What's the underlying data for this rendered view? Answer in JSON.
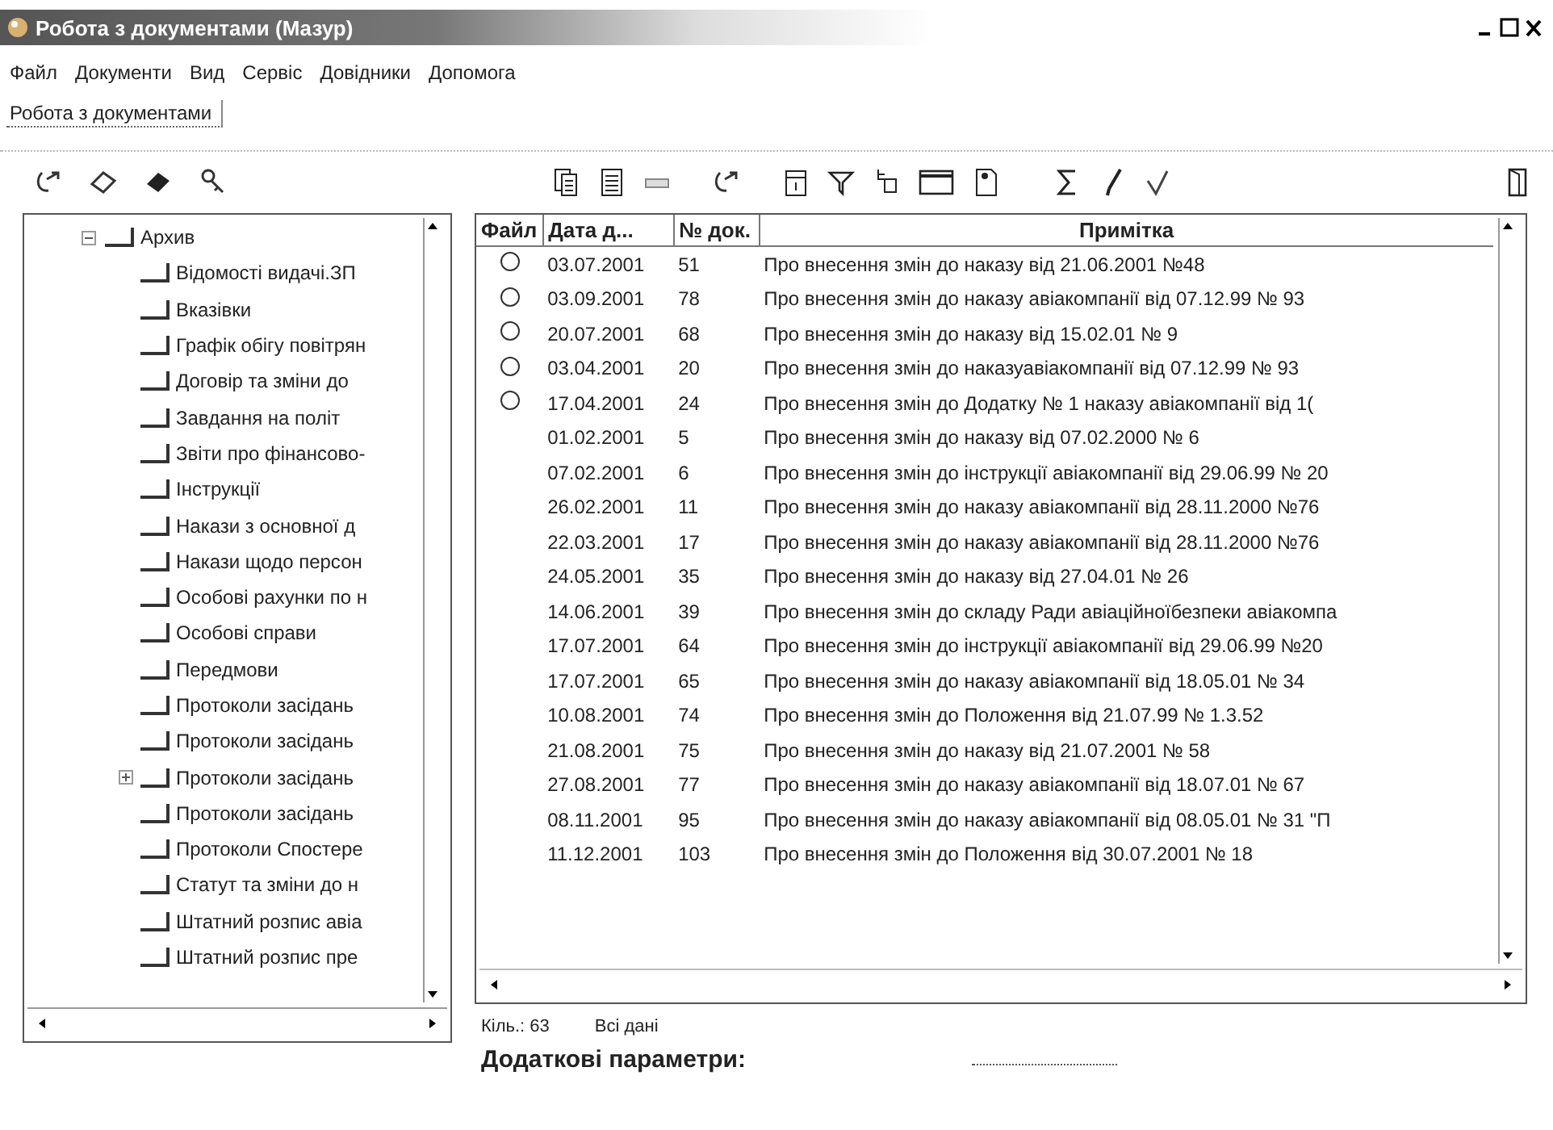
{
  "window": {
    "title": "Робота з документами (Мазур)"
  },
  "menu": [
    "Файл",
    "Документи",
    "Вид",
    "Сервіс",
    "Довідники",
    "Допомога"
  ],
  "tabs": [
    {
      "label": "Робота з документами",
      "selected": true
    }
  ],
  "tree": {
    "label": "Архив",
    "expanded": true,
    "children": [
      {
        "label": "Відомості видачі.ЗП",
        "expandable": false
      },
      {
        "label": "Вказівки",
        "expandable": false
      },
      {
        "label": "Графік обігу повітрян",
        "expandable": false
      },
      {
        "label": "Договір та зміни до",
        "expandable": false
      },
      {
        "label": "Завдання на політ",
        "expandable": false
      },
      {
        "label": "Звіти про фінансово-",
        "expandable": false
      },
      {
        "label": "Інструкції",
        "expandable": false
      },
      {
        "label": "Накази з основної д",
        "expandable": false
      },
      {
        "label": "Накази щодо персон",
        "expandable": false
      },
      {
        "label": "Особові рахунки по н",
        "expandable": false
      },
      {
        "label": "Особові справи",
        "expandable": false
      },
      {
        "label": "Передмови",
        "expandable": false
      },
      {
        "label": "Протоколи засідань",
        "expandable": false
      },
      {
        "label": "Протоколи засідань",
        "expandable": false
      },
      {
        "label": "Протоколи засідань",
        "expandable": true
      },
      {
        "label": "Протоколи засідань",
        "expandable": false
      },
      {
        "label": "Протоколи Спостере",
        "expandable": false
      },
      {
        "label": "Статут та зміни до н",
        "expandable": false
      },
      {
        "label": "Штатний розпис авіа",
        "expandable": false
      },
      {
        "label": "Штатний розпис пре",
        "expandable": false
      }
    ]
  },
  "table": {
    "columns": [
      "Файл",
      "Дата д...",
      "№ док.",
      "Примітка"
    ],
    "rows": [
      {
        "has_file": true,
        "date": "03.07.2001",
        "number": "51",
        "note": "Про внесення змін до наказу від 21.06.2001 №48"
      },
      {
        "has_file": true,
        "date": "03.09.2001",
        "number": "78",
        "note": "Про внесення змін до наказу авіакомпанії від 07.12.99 № 93"
      },
      {
        "has_file": true,
        "date": "20.07.2001",
        "number": "68",
        "note": "Про внесення змін до наказу від 15.02.01 № 9"
      },
      {
        "has_file": true,
        "date": "03.04.2001",
        "number": "20",
        "note": "Про внесення змін до наказуавіакомпанії від 07.12.99  № 93"
      },
      {
        "has_file": true,
        "date": "17.04.2001",
        "number": "24",
        "note": "Про внесення змін до  Додатку № 1  наказу авіакомпанії від 1("
      },
      {
        "has_file": false,
        "date": "01.02.2001",
        "number": "5",
        "note": "Про внесення змін до наказу від 07.02.2000 № 6"
      },
      {
        "has_file": false,
        "date": "07.02.2001",
        "number": "6",
        "note": "Про внесення змін до інструкції авіакомпанії  від  29.06.99 № 20"
      },
      {
        "has_file": false,
        "date": "26.02.2001",
        "number": "11",
        "note": "Про внесення змін до наказу  авіакомпанії від 28.11.2000 №76"
      },
      {
        "has_file": false,
        "date": "22.03.2001",
        "number": "17",
        "note": "Про внесення змін до наказу авіакомпанії від 28.11.2000  №76"
      },
      {
        "has_file": false,
        "date": "24.05.2001",
        "number": "35",
        "note": "Про внесення змін до наказу від 27.04.01 № 26"
      },
      {
        "has_file": false,
        "date": "14.06.2001",
        "number": "39",
        "note": "Про внесення змін до складу Ради авіаційноїбезпеки авіакомпа"
      },
      {
        "has_file": false,
        "date": "17.07.2001",
        "number": "64",
        "note": "Про внесення змін до інструкції авіакомпанії від 29.06.99 №20"
      },
      {
        "has_file": false,
        "date": "17.07.2001",
        "number": "65",
        "note": "Про внесення змін до наказу авіакомпанії від 18.05.01 № 34"
      },
      {
        "has_file": false,
        "date": "10.08.2001",
        "number": "74",
        "note": "Про внесення змін до Положення від 21.07.99 № 1.3.52"
      },
      {
        "has_file": false,
        "date": "21.08.2001",
        "number": "75",
        "note": "Про внесення змін до наказу  від 21.07.2001 № 58"
      },
      {
        "has_file": false,
        "date": "27.08.2001",
        "number": "77",
        "note": "Про внесення змін до наказу авіакомпанії від 18.07.01 № 67"
      },
      {
        "has_file": false,
        "date": "08.11.2001",
        "number": "95",
        "note": "Про внесення змін до наказу авіакомпанії від 08.05.01 № 31   \"П"
      },
      {
        "has_file": false,
        "date": "11.12.2001",
        "number": "103",
        "note": "Про внесення змін до Положення від 30.07.2001 № 18"
      }
    ]
  },
  "status": {
    "count": "Кіль.: 63",
    "filter": "Всі дані"
  },
  "extra": {
    "title": "Додаткові параметри:"
  }
}
